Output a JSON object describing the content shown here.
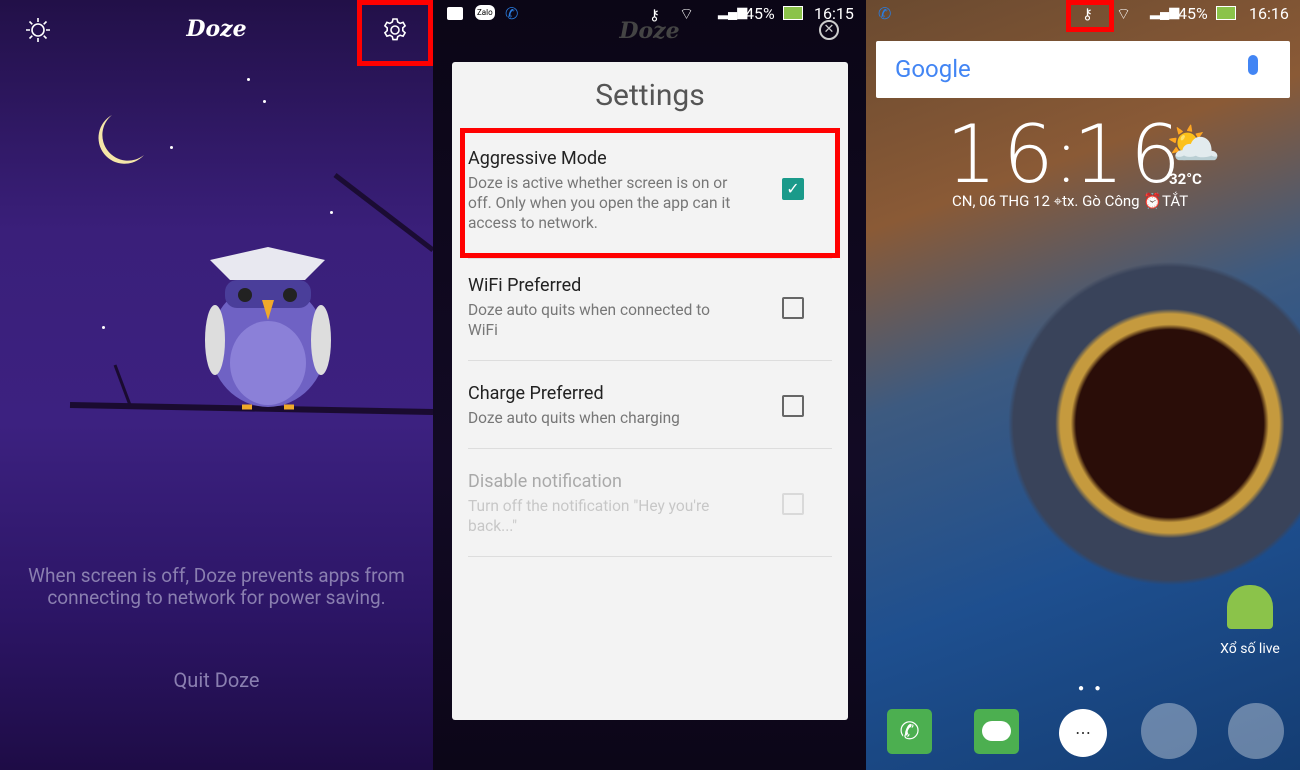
{
  "panel1": {
    "app_title": "Doze",
    "icons": {
      "brightness": "sun-icon",
      "settings": "gear-icon"
    },
    "description": "When screen is off, Doze prevents apps from connecting to network for power saving.",
    "quit_button": "Quit Doze"
  },
  "panel2": {
    "status_bar": {
      "icons": [
        "gallery-icon",
        "zalo-icon",
        "phone-call-icon",
        "vpn-key-icon",
        "wifi-icon",
        "signal-icon",
        "battery-charging-icon"
      ],
      "zalo_label": "Zalo",
      "battery": "45%",
      "time": "16:15"
    },
    "background_title": "Doze",
    "dialog": {
      "title": "Settings",
      "items": [
        {
          "title": "Aggressive Mode",
          "description": "Doze is active whether screen is on or off. Only when you open the app can it access to network.",
          "checked": true,
          "enabled": true
        },
        {
          "title": "WiFi Preferred",
          "description": "Doze auto quits when connected to WiFi",
          "checked": false,
          "enabled": true
        },
        {
          "title": "Charge Preferred",
          "description": "Doze auto quits when charging",
          "checked": false,
          "enabled": true
        },
        {
          "title": "Disable notification",
          "description": "Turn off the notification \"Hey you're back...\"",
          "checked": false,
          "enabled": false
        }
      ]
    },
    "accent_color": "#1a9a8a"
  },
  "panel3": {
    "status_bar": {
      "battery": "45%",
      "time": "16:16"
    },
    "search": {
      "logo": "Google",
      "mic": "mic-icon"
    },
    "clock": {
      "time_h": "16",
      "time_m": "16",
      "date": "CN, 06 THG 12",
      "location": "tx. Gò Công",
      "alarm": "TẮT",
      "temperature": "32°C",
      "weather": "partly-cloudy-icon"
    },
    "app_label": "Xổ số live",
    "dock": [
      "phone-icon",
      "messages-icon",
      "app-drawer-icon",
      "camera-folder-icon",
      "play-store-folder-icon"
    ]
  },
  "highlight_color": "#ff0000"
}
